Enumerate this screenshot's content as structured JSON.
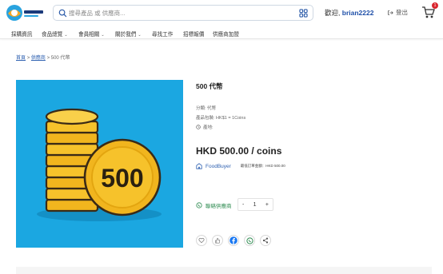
{
  "header": {
    "logo_text": "ProcureBest",
    "search_placeholder": "搜尋產品 或 供應商...",
    "welcome_prefix": "歡迎,",
    "username": "brian2222",
    "logout_label": "登出",
    "cart_count": "1"
  },
  "nav": {
    "items": [
      {
        "label": "採購資訊",
        "chevron": false
      },
      {
        "label": "食品總覽",
        "chevron": true
      },
      {
        "label": "會員相關",
        "chevron": true
      },
      {
        "label": "關於我們",
        "chevron": true
      },
      {
        "label": "尋找工作",
        "chevron": false
      },
      {
        "label": "招標報價",
        "chevron": false
      },
      {
        "label": "供應商加盟",
        "chevron": false
      }
    ]
  },
  "breadcrumb": {
    "home": "首頁",
    "sep1": ">",
    "suppliers": "供應商",
    "sep2": ">",
    "current": "500 代幣"
  },
  "product": {
    "image_label": "500",
    "title": "500 代幣",
    "category": "分類: 代幣",
    "spec": "產品包裝: HK$1 = 1Coins",
    "origin": "產地:",
    "price": "HKD 500.00 / coins",
    "seller_name": "FoodBuyer",
    "min_order": "最低訂單金額：HKD 500.00",
    "contact_label": "聯絡供應商",
    "qty_minus": "-",
    "qty_value": "1",
    "qty_plus": "+"
  },
  "colors": {
    "image_bg": "#1ba7e1",
    "coin": "#f6c22b",
    "link": "#2c5fb0",
    "whatsapp": "#2c8a4f",
    "badge": "#d9262e"
  }
}
